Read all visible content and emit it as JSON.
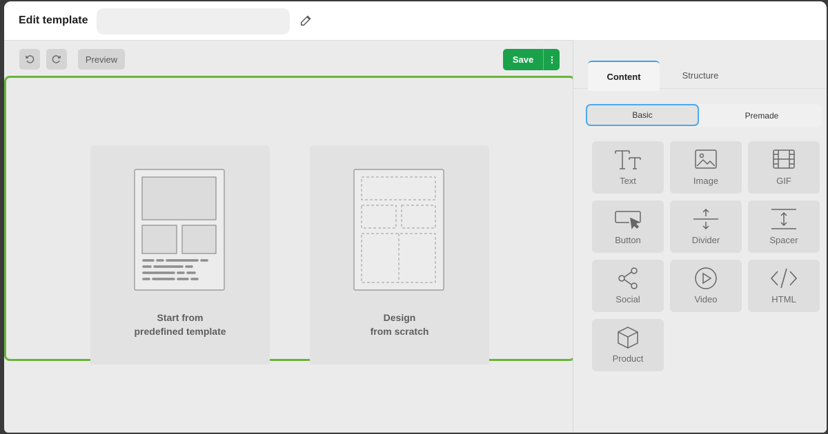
{
  "header": {
    "title": "Edit template",
    "name_value": "",
    "name_placeholder": ""
  },
  "toolbar": {
    "preview_label": "Preview",
    "save_label": "Save"
  },
  "canvas": {
    "accent_border": "#6ab43a",
    "options": [
      {
        "line1": "Start from",
        "line2": "predefined template"
      },
      {
        "line1": "Design",
        "line2": "from scratch"
      }
    ]
  },
  "panel": {
    "tabs": [
      "Content",
      "Structure"
    ],
    "segments": [
      "Basic",
      "Premade"
    ],
    "blocks": [
      {
        "label": "Text",
        "icon": "text-icon"
      },
      {
        "label": "Image",
        "icon": "image-icon"
      },
      {
        "label": "GIF",
        "icon": "gif-icon"
      },
      {
        "label": "Button",
        "icon": "button-icon"
      },
      {
        "label": "Divider",
        "icon": "divider-icon"
      },
      {
        "label": "Spacer",
        "icon": "spacer-icon"
      },
      {
        "label": "Social",
        "icon": "social-icon"
      },
      {
        "label": "Video",
        "icon": "video-icon"
      },
      {
        "label": "HTML",
        "icon": "html-icon"
      },
      {
        "label": "Product",
        "icon": "product-icon"
      }
    ]
  },
  "colors": {
    "save_green": "#1aa24a",
    "tab_accent": "#3fa0e8"
  }
}
